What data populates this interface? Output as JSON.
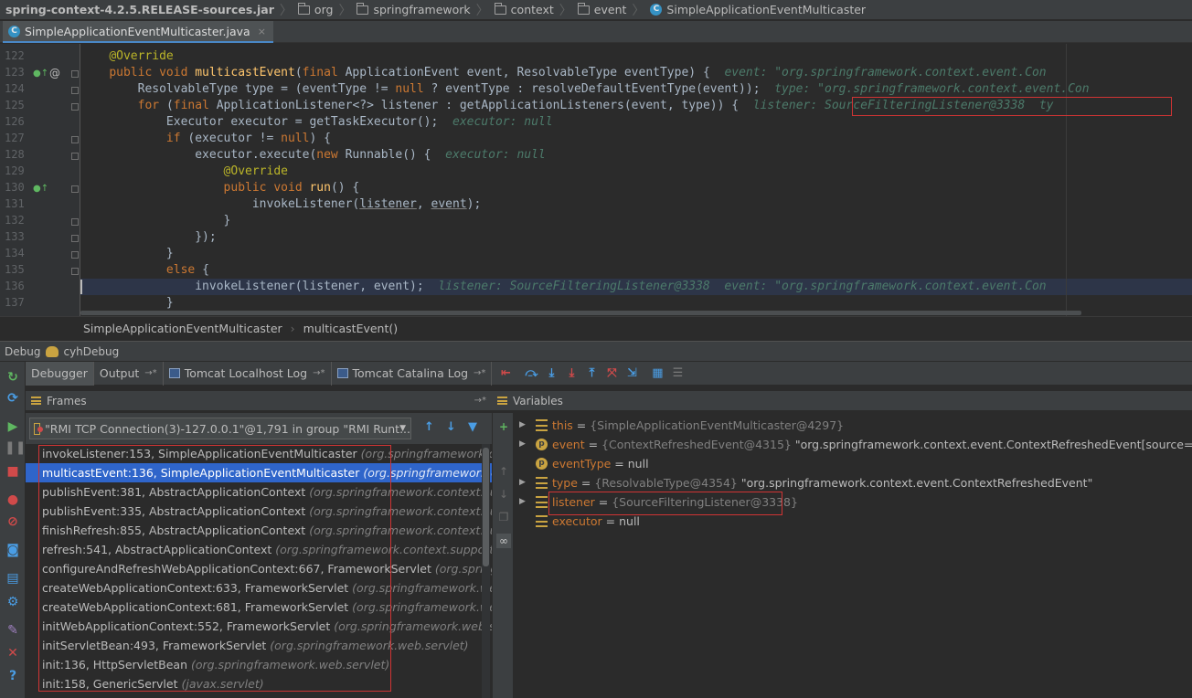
{
  "breadcrumbs": [
    {
      "label": "spring-context-4.2.5.RELEASE-sources.jar",
      "kind": "jar"
    },
    {
      "label": "org",
      "kind": "folder"
    },
    {
      "label": "springframework",
      "kind": "folder"
    },
    {
      "label": "context",
      "kind": "folder"
    },
    {
      "label": "event",
      "kind": "folder"
    },
    {
      "label": "SimpleApplicationEventMulticaster",
      "kind": "class"
    }
  ],
  "editor_tab": {
    "label": "SimpleApplicationEventMulticaster.java",
    "close": "×",
    "icon": "C"
  },
  "code": {
    "line_numbers": [
      "122",
      "123",
      "124",
      "125",
      "126",
      "127",
      "128",
      "129",
      "130",
      "131",
      "132",
      "133",
      "134",
      "135",
      "136",
      "137"
    ],
    "hints": {
      "l123": "event: \"org.springframework.context.event.Con",
      "l124": "type: \"org.springframework.context.event.Con",
      "l125": "listener: SourceFilteringListener@3338",
      "l125b": "ty",
      "l126": "executor: null",
      "l128": "executor: null",
      "l136a": "listener: SourceFilteringListener@3338",
      "l136b": "event: \"org.springframework.context.event.Con"
    }
  },
  "editor_breadcrumb": {
    "class_name": "SimpleApplicationEventMulticaster",
    "method": "multicastEvent()"
  },
  "debug_header": {
    "label": "Debug",
    "config": "cyhDebug"
  },
  "debug_tabs": [
    {
      "label": "Debugger",
      "active": true
    },
    {
      "label": "Output",
      "pin": "→*"
    },
    {
      "label": "Tomcat Localhost Log",
      "pin": "→*"
    },
    {
      "label": "Tomcat Catalina Log",
      "pin": "→*"
    }
  ],
  "frames": {
    "title": "Frames",
    "pin": "→*",
    "thread": "\"RMI TCP Connection(3)-127.0.0.1\"@1,791 in group \"RMI Runt...",
    "items": [
      {
        "method": "invokeListener:153, SimpleApplicationEventMulticaster",
        "pkg": "(org.springframework.context.event)",
        "selected": false
      },
      {
        "method": "multicastEvent:136, SimpleApplicationEventMulticaster",
        "pkg": "(org.springframework.context.event)",
        "selected": true
      },
      {
        "method": "publishEvent:381, AbstractApplicationContext",
        "pkg": "(org.springframework.context.support)",
        "selected": false
      },
      {
        "method": "publishEvent:335, AbstractApplicationContext",
        "pkg": "(org.springframework.context.support)",
        "selected": false
      },
      {
        "method": "finishRefresh:855, AbstractApplicationContext",
        "pkg": "(org.springframework.context.support)",
        "selected": false
      },
      {
        "method": "refresh:541, AbstractApplicationContext",
        "pkg": "(org.springframework.context.support)",
        "selected": false
      },
      {
        "method": "configureAndRefreshWebApplicationContext:667, FrameworkServlet",
        "pkg": "(org.springframework.web.servlet)",
        "selected": false
      },
      {
        "method": "createWebApplicationContext:633, FrameworkServlet",
        "pkg": "(org.springframework.web.servlet)",
        "selected": false
      },
      {
        "method": "createWebApplicationContext:681, FrameworkServlet",
        "pkg": "(org.springframework.web.servlet)",
        "selected": false
      },
      {
        "method": "initWebApplicationContext:552, FrameworkServlet",
        "pkg": "(org.springframework.web.servlet)",
        "selected": false
      },
      {
        "method": "initServletBean:493, FrameworkServlet",
        "pkg": "(org.springframework.web.servlet)",
        "selected": false
      },
      {
        "method": "init:136, HttpServletBean",
        "pkg": "(org.springframework.web.servlet)",
        "selected": false
      },
      {
        "method": "init:158, GenericServlet",
        "pkg": "(javax.servlet)",
        "selected": false
      }
    ]
  },
  "variables": {
    "title": "Variables",
    "items": [
      {
        "name": "this",
        "eq": " = ",
        "type": "{SimpleApplicationEventMulticaster@4297}",
        "value": "",
        "kind": "field",
        "expandable": true
      },
      {
        "name": "event",
        "eq": " = ",
        "type": "{ContextRefreshedEvent@4315}",
        "value": " \"org.springframework.context.event.ContextRefreshedEvent[source=WebApplica",
        "kind": "param",
        "expandable": true
      },
      {
        "name": "eventType",
        "eq": " = ",
        "type": "",
        "value": "null",
        "kind": "param",
        "expandable": false
      },
      {
        "name": "type",
        "eq": " = ",
        "type": "{ResolvableType@4354}",
        "value": " \"org.springframework.context.event.ContextRefreshedEvent\"",
        "kind": "field",
        "expandable": true
      },
      {
        "name": "listener",
        "eq": " = ",
        "type": "{SourceFilteringListener@3338}",
        "value": "",
        "kind": "field",
        "expandable": true
      },
      {
        "name": "executor",
        "eq": " = ",
        "type": "",
        "value": "null",
        "kind": "field",
        "expandable": false
      }
    ]
  },
  "colors": {
    "accent": "#2f65ca",
    "highlight_box": "#d03434",
    "keyword": "#cc7832",
    "annotation": "#bbb529",
    "method": "#ffc66d"
  }
}
